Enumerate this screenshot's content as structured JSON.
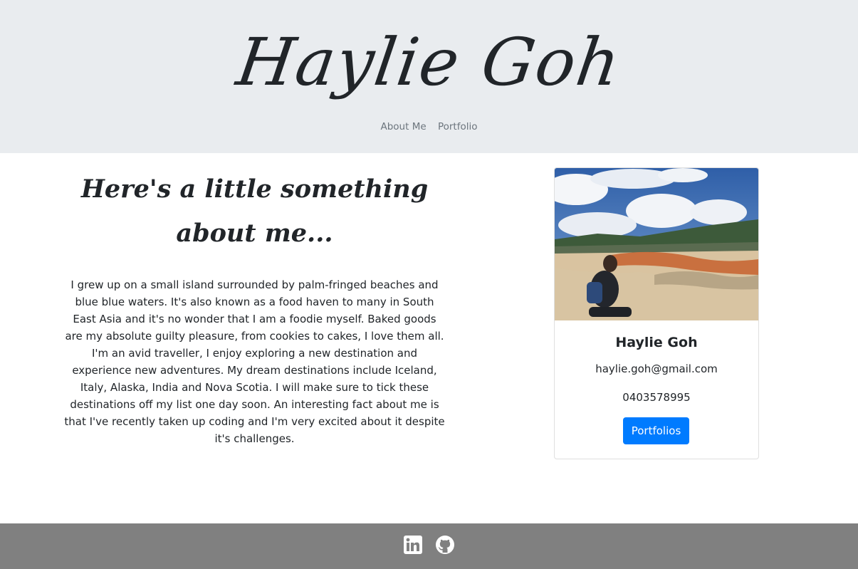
{
  "header": {
    "title": "Haylie Goh",
    "nav": [
      {
        "label": "About Me"
      },
      {
        "label": "Portfolio"
      }
    ]
  },
  "about": {
    "heading": "Here's a little something about me...",
    "body": "I grew up on a small island surrounded by palm-fringed beaches and blue blue waters. It's also known as a food haven to many in South East Asia and it's no wonder that I am a foodie myself. Baked goods are my absolute guilty pleasure, from cookies to cakes, I love them all. I'm an avid traveller, I enjoy exploring a new destination and experience new adventures. My dream destinations include Iceland, Italy, Alaska, India and Nova Scotia. I will make sure to tick these destinations off my list one day soon. An interesting fact about me is that I've recently taken up coding and I'm very excited about it despite it's challenges."
  },
  "card": {
    "name": "Haylie Goh",
    "email": "haylie.goh@gmail.com",
    "phone": "0403578995",
    "button_label": "Portfolios"
  },
  "footer": {
    "icons": [
      "linkedin-icon",
      "github-icon"
    ]
  },
  "colors": {
    "header_bg": "#e9ecef",
    "footer_bg": "#808080",
    "button_bg": "#007bff",
    "text": "#212529",
    "nav_text": "#6c757d"
  }
}
